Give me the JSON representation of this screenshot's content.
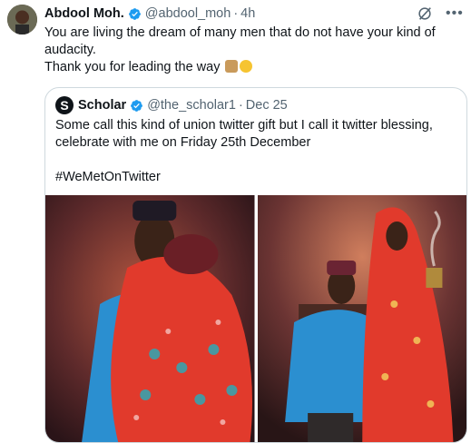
{
  "tweet": {
    "author_name": "Abdool Moh.",
    "author_handle": "@abdool_moh",
    "time": "4h",
    "lines": [
      "You are living the dream of many men that do not have your kind of",
      "audacity.",
      "Thank you for leading the way"
    ]
  },
  "quoted": {
    "author_name": "Scholar",
    "author_handle": "@the_scholar1",
    "date": "Dec 25",
    "lines": [
      "Some call this kind of union twitter gift but I call it twitter blessing,",
      "celebrate with me on Friday 25th December",
      "",
      "#WeMetOnTwitter"
    ]
  },
  "colors": {
    "verified": "#1d9bf0",
    "text_primary": "#0f1419",
    "text_muted": "#536471",
    "border": "#cfd9de"
  },
  "icons": [
    "verified-badge-icon",
    "grok-icon",
    "more-icon",
    "raised-hands-emoji",
    "sunglasses-emoji"
  ]
}
